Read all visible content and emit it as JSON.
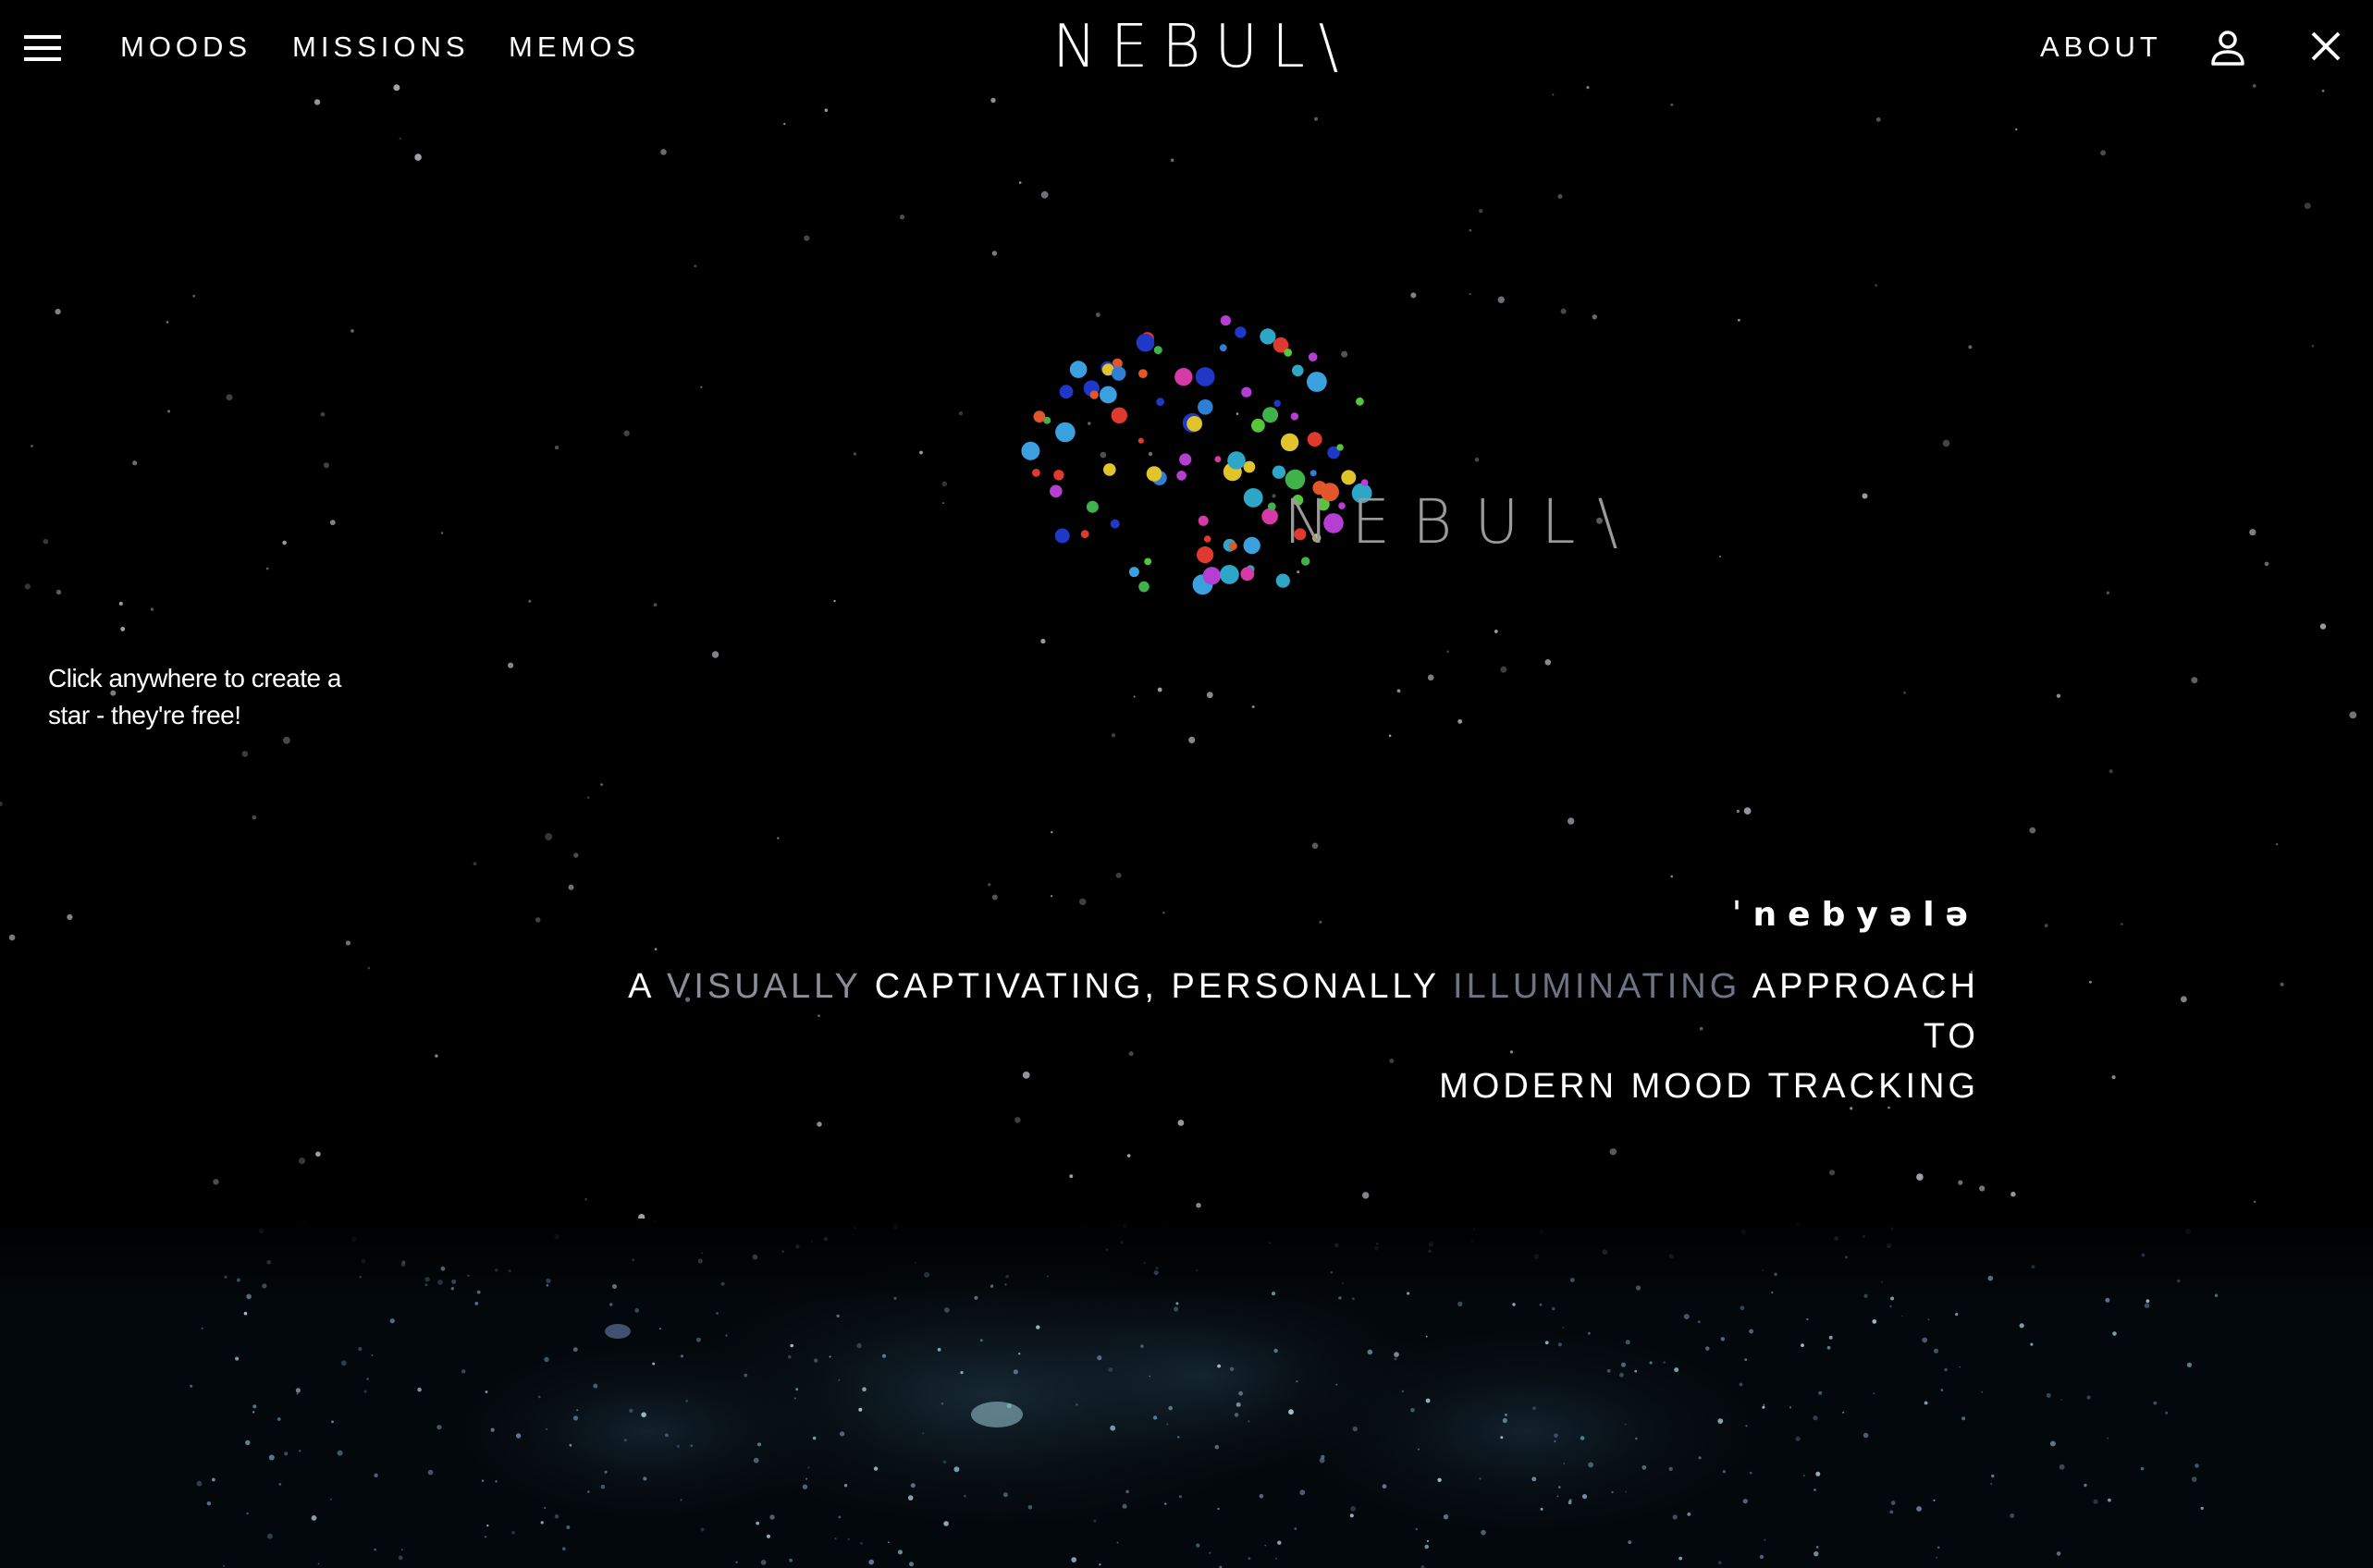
{
  "nav": {
    "links": [
      "MOODS",
      "MISSIONS",
      "MEMOS"
    ],
    "brand": "NEBUL\\",
    "about": "ABOUT"
  },
  "logo": {
    "word": "NEBUL\\"
  },
  "hint": "Click anywhere to create a star - they're free!",
  "phonetic": "ˈnebyələ",
  "tagline": {
    "w1": "A",
    "w2": "VISUALLY",
    "w3": "CAPTIVATING, PERSONALLY",
    "w4": "ILLUMINATING",
    "w5": "APPROACH TO",
    "line2": "MODERN MOOD TRACKING"
  },
  "colors": {
    "background": "#000000",
    "text": "#ffffff",
    "dim_text": "#8a8f99",
    "logo_text": "#9a9a9a"
  }
}
